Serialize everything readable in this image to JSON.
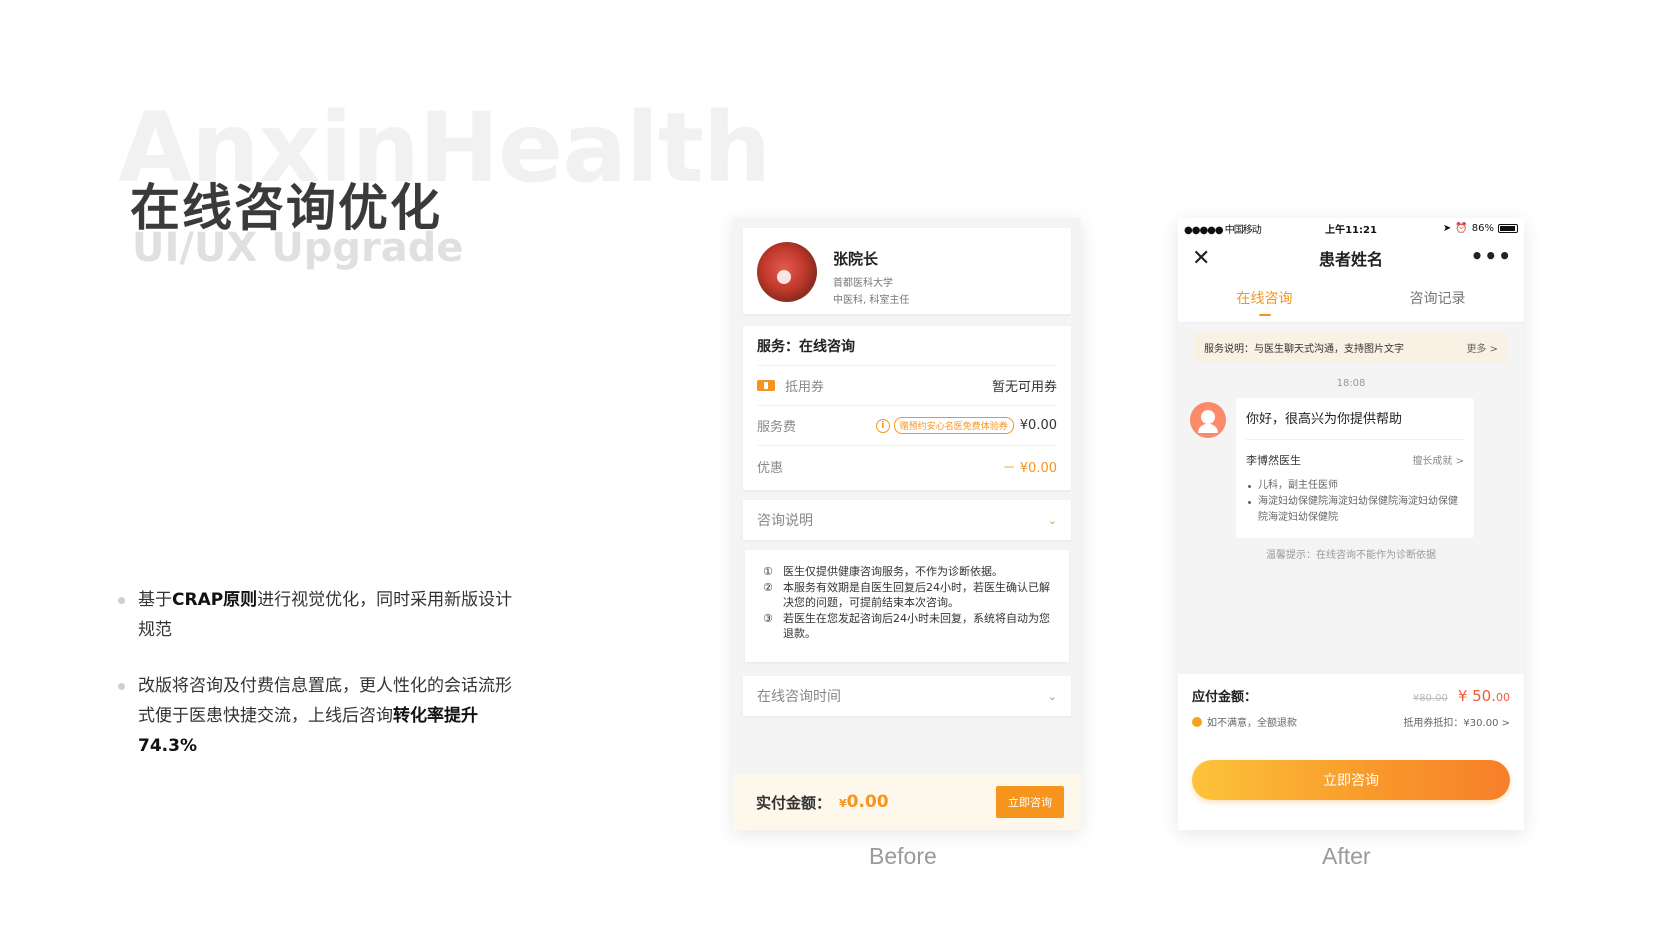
{
  "hero": {
    "watermark": "AnxinHealth",
    "title": "在线咨询优化",
    "subtitle": "UI/UX Upgrade"
  },
  "bullets": [
    {
      "pre": "基于",
      "bold1": "CRAP原则",
      "post": "进行视觉优化，同时采用新版设计规范"
    },
    {
      "pre": "改版将咨询及付费信息置底，更人性化的会话流形式便于医患快捷交流，上线后咨询",
      "bold1": "转化率提升74.3%"
    }
  ],
  "captions": {
    "before": "Before",
    "after": "After"
  },
  "before": {
    "doctor": {
      "name": "张院长",
      "school": "首都医科大学",
      "dept": "中医科, 科室主任"
    },
    "service": {
      "title": "服务：在线咨询",
      "coupon_label": "抵用券",
      "coupon_value": "暂无可用券",
      "fee_label": "服务费",
      "promo": "赠预约安心名医免费体验券",
      "fee_value": "¥0.00",
      "discount_label": "优惠",
      "discount_value": "－ ¥0.00"
    },
    "notes_title": "咨询说明",
    "notes": [
      {
        "num": "①",
        "text": "医生仅提供健康咨询服务，不作为诊断依据。"
      },
      {
        "num": "②",
        "text": "本服务有效期是自医生回复后24小时，若医生确认已解决您的问题，可提前结束本次咨询。"
      },
      {
        "num": "③",
        "text": "若医生在您发起咨询后24小时未回复，系统将自动为您退款。"
      }
    ],
    "time_title": "在线咨询时间",
    "bottom": {
      "label": "实付金额：",
      "currency": "¥",
      "amount": "0.00",
      "button": "立即咨询"
    }
  },
  "after": {
    "status": {
      "carrier": "●●●●● 中国移动",
      "time": "上午11:21",
      "battery": "86%"
    },
    "nav_title": "患者姓名",
    "tabs": [
      "在线咨询",
      "咨询记录"
    ],
    "service_note": "服务说明：与医生聊天式沟通，支持图片文字",
    "more": "更多 >",
    "time": "18:08",
    "greeting": "你好，很高兴为你提供帮助",
    "doctor": "李博然医生",
    "skill": "擅长成就 >",
    "details": [
      "儿科，副主任医师",
      "海淀妇幼保健院海淀妇幼保健院海淀妇幼保健院海淀妇幼保健院"
    ],
    "warm_tip": "温馨提示：在线咨询不能作为诊断依据",
    "pay_label": "应付金额：",
    "orig_price": "¥80.00",
    "price_int": "¥ 50.",
    "price_dec": "00",
    "refund": "如不满意，全额退款",
    "coupon_deduct": "抵用券抵扣：¥30.00 >",
    "button": "立即咨询"
  },
  "colors": {
    "accent": "#f7941e",
    "price": "#f25a3a"
  }
}
